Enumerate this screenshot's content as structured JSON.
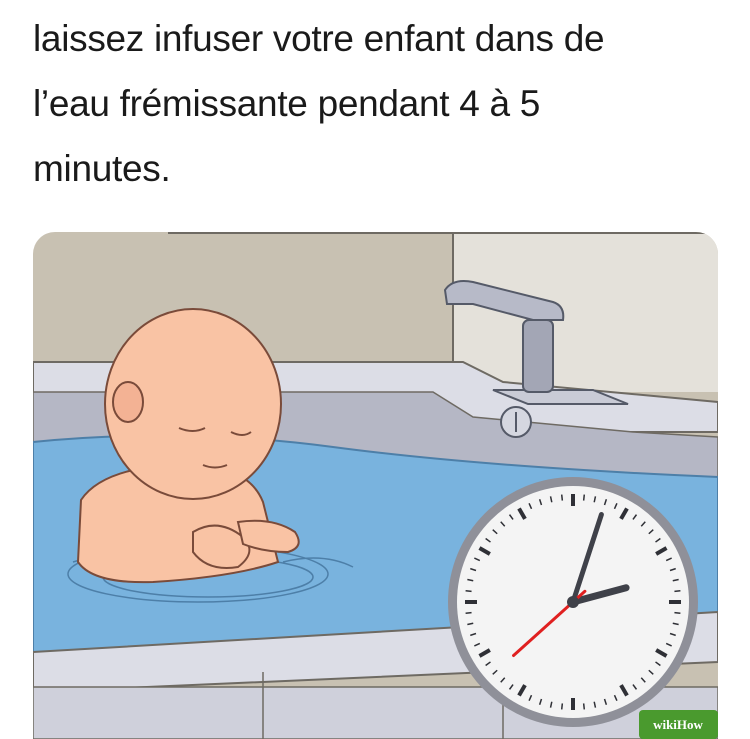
{
  "caption": {
    "lines": [
      "laissez infuser votre enfant dans de",
      "l’eau frémissante pendant 4 à 5",
      "minutes."
    ]
  },
  "illustration": {
    "watermark": "wikiHow",
    "colors": {
      "wall": "#c8c1b2",
      "wall_light": "#e4e1da",
      "tub_rim": "#dcdde6",
      "tub_inner": "#b5b7c5",
      "water": "#79b3de",
      "skin": "#f9c3a4",
      "clock_face": "#f4f4f4",
      "clock_second_hand": "#e02020",
      "watermark_bg": "#4a9a2e"
    }
  },
  "clock": {
    "hour": 2.5,
    "minute": 3,
    "second": 38
  }
}
